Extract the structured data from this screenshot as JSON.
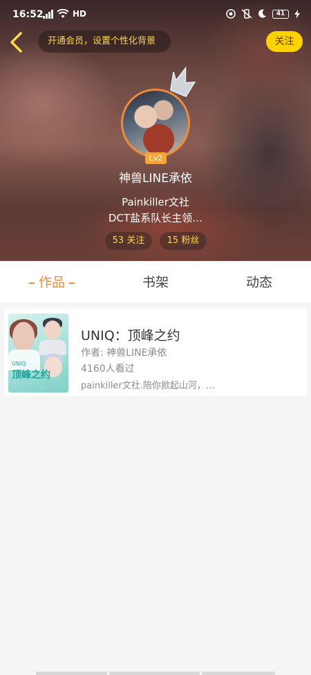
{
  "status_bar": {
    "time": "16:52",
    "network": "4G",
    "hd_label": "HD",
    "battery": "41"
  },
  "header": {
    "vip_banner": "开通会员，设置个性化背景",
    "follow_label": "关注",
    "level": "Lv2",
    "username": "神兽LINE承依",
    "bio_line1": "Painkiller文社",
    "bio_line2": "DCT盐系队长主领…",
    "following_count": "53 关注",
    "fans_count": "15 粉丝",
    "accent_color": "#f08a3c",
    "follow_button_color": "#ffd200"
  },
  "tabs": [
    {
      "label": "作品",
      "active": true
    },
    {
      "label": "书架",
      "active": false
    },
    {
      "label": "动态",
      "active": false
    }
  ],
  "works": [
    {
      "title": "UNIQ：顶峰之约",
      "author": "作者: 神兽LINE承依",
      "views": "4160人看过",
      "description": "painkiller文社.陪你掀起山河，…",
      "cover_title": "顶峰之约",
      "cover_prefix": "UNIQ"
    }
  ]
}
